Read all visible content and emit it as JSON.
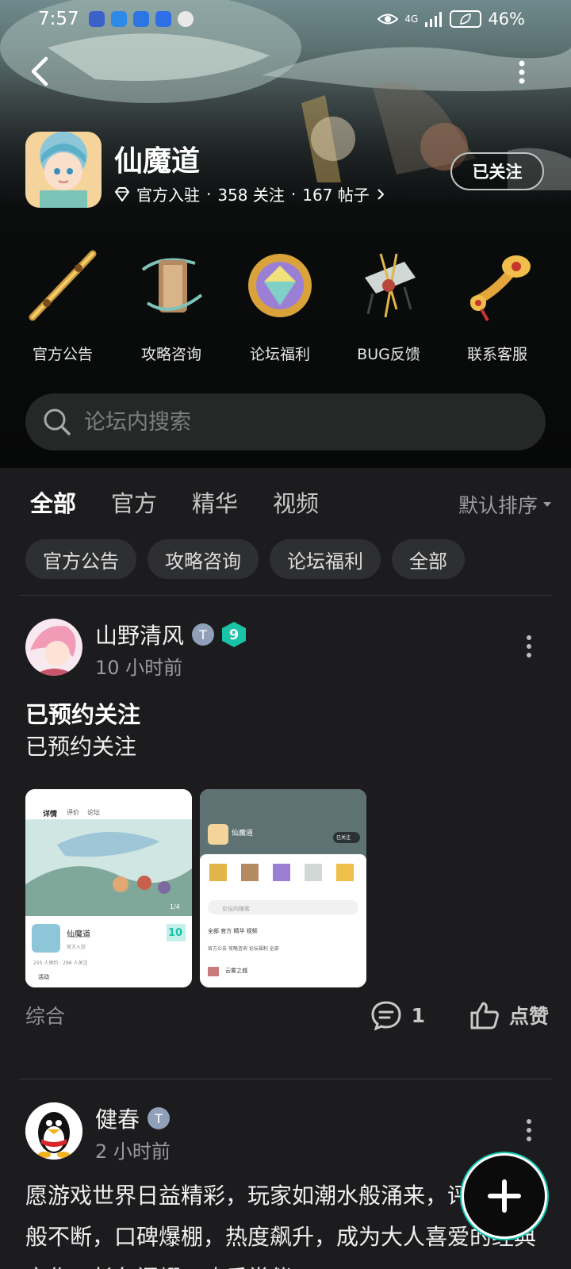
{
  "status_bar": {
    "time": "7:57",
    "battery": "46%",
    "signal": "4G",
    "notif_icons": [
      "app-icon",
      "cloud-icon",
      "weather-icon",
      "bulb-icon",
      "message-icon"
    ]
  },
  "forum": {
    "name": "仙魔道",
    "badge": "官方入驻",
    "follows": "358 关注",
    "posts": "167 帖子",
    "sep": "·",
    "follow_button": "已关注"
  },
  "shortcuts": [
    {
      "label": "官方公告",
      "icon": "brush-icon"
    },
    {
      "label": "攻略咨询",
      "icon": "scroll-icon"
    },
    {
      "label": "论坛福利",
      "icon": "gem-icon"
    },
    {
      "label": "BUG反馈",
      "icon": "bug-icon"
    },
    {
      "label": "联系客服",
      "icon": "ruyi-icon"
    }
  ],
  "search": {
    "placeholder": "论坛内搜索"
  },
  "tabs": [
    {
      "label": "全部",
      "active": true
    },
    {
      "label": "官方"
    },
    {
      "label": "精华"
    },
    {
      "label": "视频"
    }
  ],
  "sort": {
    "label": "默认排序"
  },
  "chips": [
    "官方公告",
    "攻略咨询",
    "论坛福利",
    "全部"
  ],
  "posts": [
    {
      "author": "山野清风",
      "level": "9",
      "time": "10 小时前",
      "title": "已预约关注",
      "body": "已预约关注",
      "category": "综合",
      "comments": "1",
      "like_label": "点赞",
      "thumb1": {
        "tab1": "详情",
        "tab2": "评价",
        "tab3": "论坛",
        "app": "仙魔道",
        "sub": "官方入驻",
        "counter": "1/4",
        "days": "10",
        "stats": "255 人预约 · 296 人关注",
        "activity": "活动"
      },
      "thumb2": {
        "name": "仙魔道",
        "search": "论坛内搜索",
        "tabs": "全部 官方 精华 视频",
        "chips": "官方公告 攻略咨询 论坛福利 全部",
        "user": "云雾之城",
        "follow": "已关注"
      }
    },
    {
      "author": "健春",
      "time": "2 小时前",
      "body": "愿游戏世界日益精彩，玩家如潮水般涌来，评如春风般不断，口碑爆棚，热度飙升，成为大人喜爱的经典之作，长久闪耀，欢乐常伴！"
    }
  ],
  "colors": {
    "accent": "#0fc7b0",
    "bg": "#1c1c1e"
  }
}
